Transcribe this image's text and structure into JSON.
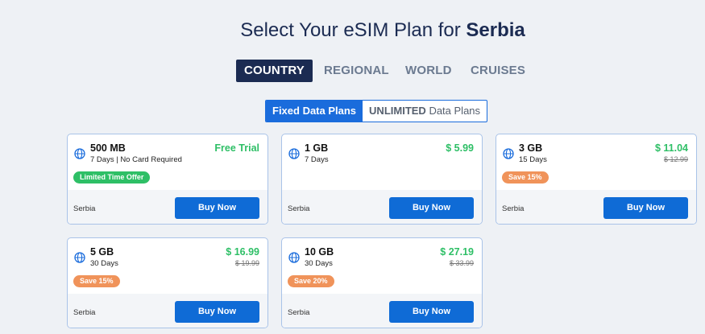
{
  "header": {
    "title_prefix": "Select Your eSIM Plan for ",
    "country": "Serbia"
  },
  "tabs": [
    {
      "label": "COUNTRY",
      "active": true
    },
    {
      "label": "REGIONAL",
      "active": false
    },
    {
      "label": "WORLD",
      "active": false
    },
    {
      "label": "CRUISES",
      "active": false
    }
  ],
  "plan_toggle": {
    "fixed": "Fixed Data Plans",
    "unlimited_bold": "UNLIMITED",
    "unlimited_rest": " Data Plans"
  },
  "plans": [
    {
      "data": "500 MB",
      "validity": "7 Days | No Card Required",
      "price": "Free Trial",
      "old_price": "",
      "badge": "Limited Time Offer",
      "badge_color": "#2ebf66",
      "country": "Serbia",
      "button": "Buy Now"
    },
    {
      "data": "1 GB",
      "validity": "7 Days",
      "price": "$ 5.99",
      "old_price": "",
      "badge": "",
      "badge_color": "",
      "country": "Serbia",
      "button": "Buy Now"
    },
    {
      "data": "3 GB",
      "validity": "15 Days",
      "price": "$ 11.04",
      "old_price": "$ 12.99",
      "badge": "Save 15%",
      "badge_color": "#f0935a",
      "country": "Serbia",
      "button": "Buy Now"
    },
    {
      "data": "5 GB",
      "validity": "30 Days",
      "price": "$ 16.99",
      "old_price": "$ 19.99",
      "badge": "Save 15%",
      "badge_color": "#f0935a",
      "country": "Serbia",
      "button": "Buy Now"
    },
    {
      "data": "10 GB",
      "validity": "30 Days",
      "price": "$ 27.19",
      "old_price": "$ 33.99",
      "badge": "Save 20%",
      "badge_color": "#f0935a",
      "country": "Serbia",
      "button": "Buy Now"
    }
  ],
  "colors": {
    "accent": "#1a6cdc",
    "navy": "#1b2b52",
    "price_green": "#2ebf66",
    "badge_orange": "#f0935a"
  }
}
